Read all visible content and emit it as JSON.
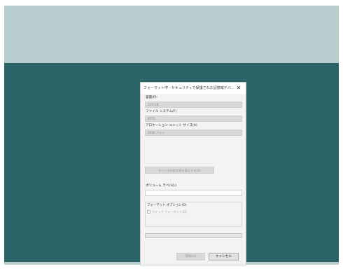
{
  "dialog": {
    "title": "フォーマット中 - セキュリティで保護された記憶域デバ...",
    "close_glyph": "✕",
    "capacity": {
      "label": "容量(P):",
      "value": "119 GB"
    },
    "file_system": {
      "label": "ファイル システム(F)",
      "value": "NTFS"
    },
    "allocation_unit": {
      "label": "アロケーション ユニット サイズ(A)",
      "value": "4096 バイト"
    },
    "restore_button": "デバイスの既定値を復元する(D)",
    "volume_label": {
      "label": "ボリューム ラベル(L)",
      "value": ""
    },
    "format_options": {
      "label": "フォーマット オプション(O)",
      "quick_format": "クイック フォーマット(Q)",
      "quick_format_checked": false
    },
    "progress": {
      "fraction": 0.0,
      "fill_color": "#06b025"
    },
    "start_button": "開始(S)",
    "cancel_button": "キャンセル"
  },
  "colors": {
    "top_band": "#b7cccc",
    "desktop": "#2b6366",
    "dialog_bg": "#f3f3f3"
  }
}
